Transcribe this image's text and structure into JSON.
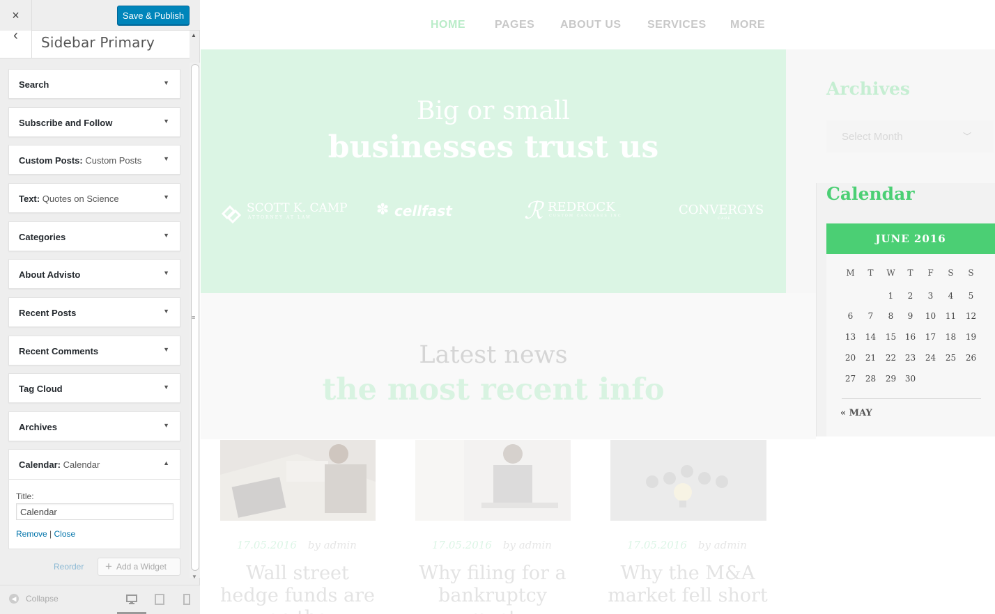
{
  "customizer": {
    "close_label": "×",
    "publish_label": "Save & Publish",
    "back_label": "‹",
    "section_title": "Sidebar Primary",
    "widgets": [
      {
        "title": "Search",
        "subtitle": ""
      },
      {
        "title": "Subscribe and Follow",
        "subtitle": ""
      },
      {
        "title": "Custom Posts:",
        "subtitle": " Custom Posts"
      },
      {
        "title": "Text:",
        "subtitle": " Quotes on Science"
      },
      {
        "title": "Categories",
        "subtitle": ""
      },
      {
        "title": "About Advisto",
        "subtitle": ""
      },
      {
        "title": "Recent Posts",
        "subtitle": ""
      },
      {
        "title": "Recent Comments",
        "subtitle": ""
      },
      {
        "title": "Tag Cloud",
        "subtitle": ""
      },
      {
        "title": "Archives",
        "subtitle": ""
      }
    ],
    "calendar_widget": {
      "title": "Calendar:",
      "subtitle": " Calendar",
      "field_label": "Title:",
      "field_value": "Calendar",
      "remove_label": "Remove",
      "separator": "|",
      "close_label": "Close"
    },
    "reorder_label": "Reorder",
    "add_widget_label": "Add a Widget",
    "collapse_label": "Collapse"
  },
  "preview": {
    "nav": [
      "HOME",
      "PAGES",
      "ABOUT US",
      "SERVICES",
      "MORE"
    ],
    "hero": {
      "line1": "Big or small",
      "line2": "businesses trust us",
      "logos": [
        {
          "name": "SCOTT K. CAMP",
          "sub": "ATTORNEY AT LAW"
        },
        {
          "name": "cellfast",
          "sub": ""
        },
        {
          "name": "REDROCK",
          "sub": "CUSTOM CANVASES INC"
        },
        {
          "name": "CONVERGYS",
          "sub": "CARE"
        }
      ]
    },
    "archives": {
      "title": "Archives",
      "select_placeholder": "Select Month"
    },
    "calendar": {
      "title": "Calendar",
      "month": "JUNE 2016",
      "weekdays": [
        "M",
        "T",
        "W",
        "T",
        "F",
        "S",
        "S"
      ],
      "weeks": [
        [
          "",
          "",
          "1",
          "2",
          "3",
          "4",
          "5"
        ],
        [
          "6",
          "7",
          "8",
          "9",
          "10",
          "11",
          "12"
        ],
        [
          "13",
          "14",
          "15",
          "16",
          "17",
          "18",
          "19"
        ],
        [
          "20",
          "21",
          "22",
          "23",
          "24",
          "25",
          "26"
        ],
        [
          "27",
          "28",
          "29",
          "30",
          "",
          "",
          ""
        ]
      ],
      "prev_link": "« MAY"
    },
    "news": {
      "line1": "Latest news",
      "line2": "the most recent info",
      "posts": [
        {
          "date": "17.05.2016",
          "author": "by admin",
          "title": "Wall street hedge funds are on the"
        },
        {
          "date": "17.05.2016",
          "author": "by admin",
          "title": "Why filing for a bankruptcy must"
        },
        {
          "date": "17.05.2016",
          "author": "by admin",
          "title": "Why the M&A market fell short"
        }
      ]
    },
    "colors": {
      "accent": "#4bcf74",
      "publish": "#0085ba",
      "link": "#0073aa"
    }
  }
}
